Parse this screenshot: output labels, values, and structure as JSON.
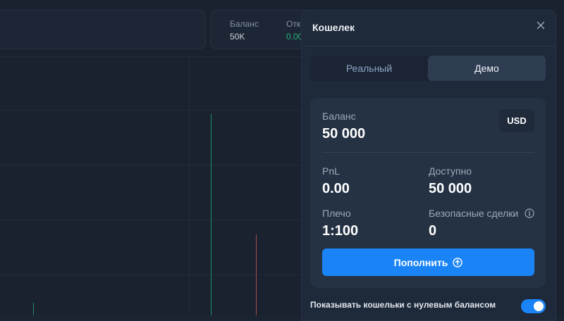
{
  "topbar": {
    "balance_label": "Баланс",
    "balance_value": "50K",
    "pnl_label_partial": "Отк",
    "pnl_value_partial": "0.00"
  },
  "wallet": {
    "title": "Кошелек",
    "tabs": [
      {
        "label": "Реальный",
        "active": false
      },
      {
        "label": "Демо",
        "active": true
      }
    ],
    "currency": "USD",
    "balance_label": "Баланс",
    "balance_value": "50 000",
    "pnl_label": "PnL",
    "pnl_value": "0.00",
    "available_label": "Доступно",
    "available_value": "50 000",
    "leverage_label": "Плечо",
    "leverage_value": "1:100",
    "safe_trades_label": "Безопасные сделки",
    "safe_trades_value": "0",
    "deposit_button": "Пополнить",
    "zero_balance_label": "Показывать кошельки с нулевым балансом",
    "zero_balance_enabled": true
  },
  "colors": {
    "accent": "#1a84f7",
    "panel": "#1e2939",
    "card": "#253244",
    "positive": "#25b07a",
    "negative": "#c0504d"
  }
}
